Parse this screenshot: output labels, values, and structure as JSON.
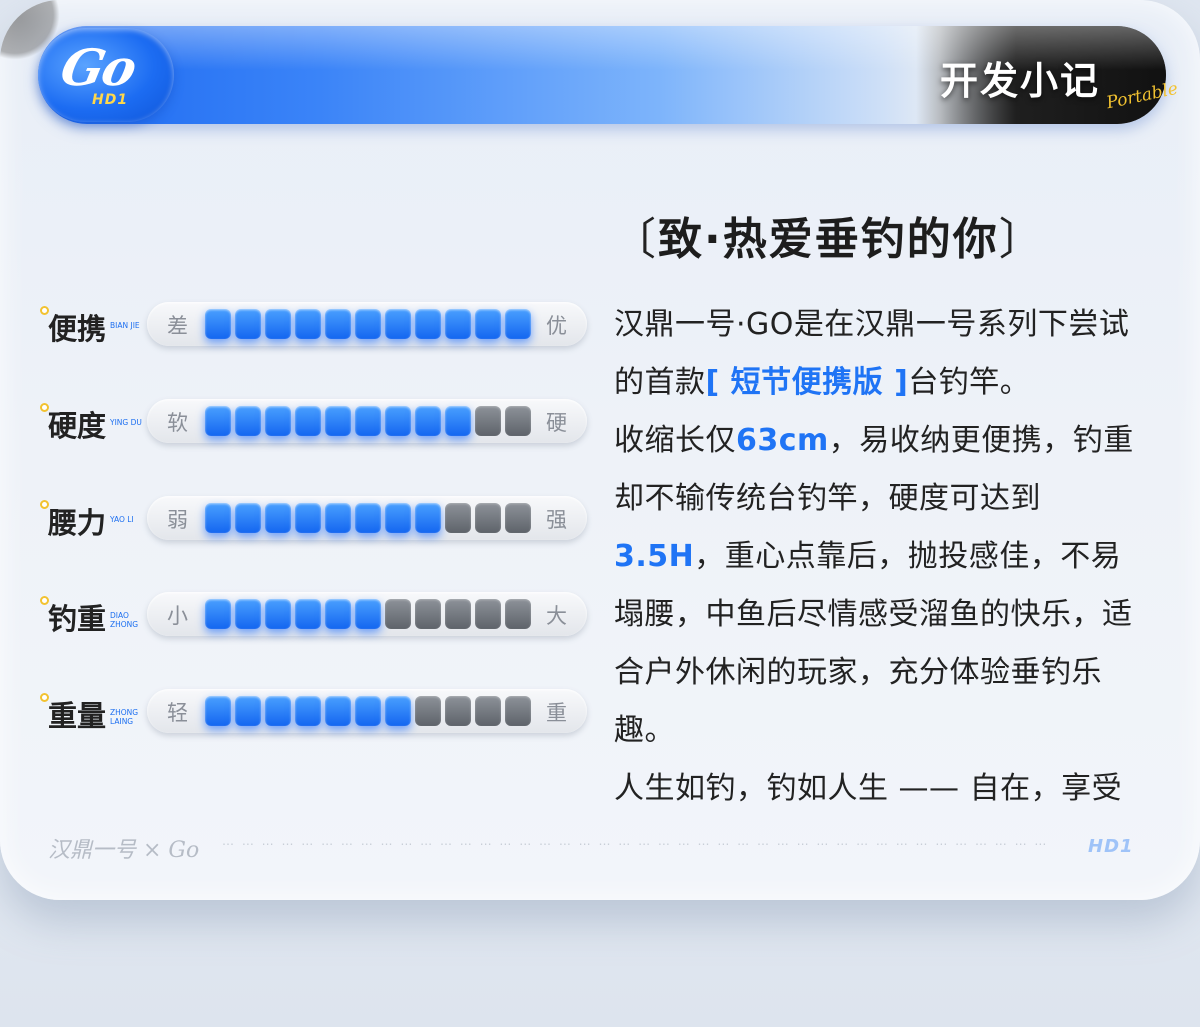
{
  "header": {
    "logo_text": "Go",
    "logo_sub": "HD1",
    "title": "开发小记",
    "title_sub": "Portable"
  },
  "stats": [
    {
      "label": "便携",
      "pinyin": "BIAN JIE",
      "min": "差",
      "max": "优",
      "level": 11,
      "total": 11
    },
    {
      "label": "硬度",
      "pinyin": "YING DU",
      "min": "软",
      "max": "硬",
      "level": 9,
      "total": 11
    },
    {
      "label": "腰力",
      "pinyin": "YAO LI",
      "min": "弱",
      "max": "强",
      "level": 8,
      "total": 11
    },
    {
      "label": "钓重",
      "pinyin": "DIAO ZHONG",
      "min": "小",
      "max": "大",
      "level": 6,
      "total": 11
    },
    {
      "label": "重量",
      "pinyin": "ZHONG LAING",
      "min": "轻",
      "max": "重",
      "level": 7,
      "total": 11
    }
  ],
  "intro": {
    "bracket_left": "〔",
    "title": "致·热爱垂钓的你",
    "bracket_right": "〕",
    "p1_a": "汉鼎一号·GO是在汉鼎一号系列下尝试的首款",
    "p1_hl": "[ 短节便携版 ]",
    "p1_b": "台钓竿。",
    "p2_a": "收缩长仅",
    "p2_hl1": "63cm",
    "p2_b": "，易收纳更便携，钓重却不输传统台钓竿，硬度可达到",
    "p2_hl2": "3.5H",
    "p2_c": "，重心点靠后，抛投感佳，不易塌腰，中鱼后尽情感受溜鱼的快乐，适合户外休闲的玩家，充分体验垂钓乐趣。",
    "p3": "人生如钓，钓如人生 —— 自在，享受"
  },
  "footer": {
    "brand": "汉鼎一号 × Go",
    "dots": "… … … … … … … … … … … … … … … … … … … … … … … … … … … … … … … … … … … … … … … … … …",
    "mark": "HD1"
  },
  "colors": {
    "accent": "#1f74f5",
    "segment_on": "#1466f0",
    "segment_off": "#6b7077",
    "header_dark": "#1f1f1f",
    "gold": "#f2c230"
  }
}
